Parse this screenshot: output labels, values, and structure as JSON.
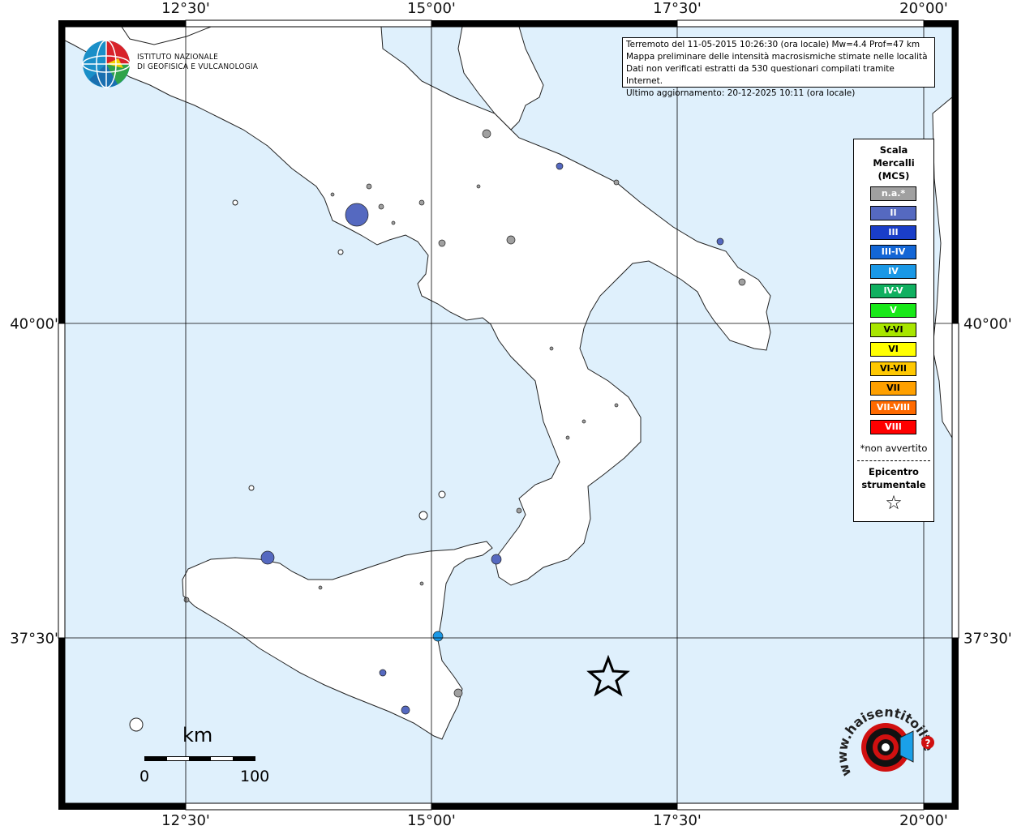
{
  "map": {
    "lon_labels": [
      "12°30'",
      "15°00'",
      "17°30'",
      "20°00'"
    ],
    "lat_labels": [
      "40°00'",
      "37°30'"
    ],
    "colors": {
      "sea": "#dff0fc",
      "land": "#ffffff",
      "frame": "#000000"
    },
    "epicenter_symbol": "star-outline"
  },
  "info_box": {
    "line1": "Terremoto del 11-05-2015 10:26:30 (ora locale) Mw=4.4 Prof=47 km",
    "line2": "Mappa preliminare delle intensità macrosismiche stimate nelle località",
    "line3": "Dati non verificati estratti da 530 questionari compilati tramite Internet.",
    "line4": "Ultimo aggiornamento: 20-12-2025 10:11 (ora locale)"
  },
  "logo": {
    "line1": "ISTITUTO NAZIONALE",
    "line2": "DI GEOFISICA E VULCANOLOGIA",
    "icon": "globe-icon"
  },
  "legend": {
    "title1": "Scala",
    "title2": "Mercalli",
    "title3": "(MCS)",
    "items": [
      {
        "label": "n.a.*",
        "color": "#a0a0a0"
      },
      {
        "label": "II",
        "color": "#5569c0"
      },
      {
        "label": "III",
        "color": "#1a3ec8"
      },
      {
        "label": "III-IV",
        "color": "#1366d6"
      },
      {
        "label": "IV",
        "color": "#1a98e6"
      },
      {
        "label": "IV-V",
        "color": "#10b060"
      },
      {
        "label": "V",
        "color": "#18e818"
      },
      {
        "label": "V-VI",
        "color": "#a8e600"
      },
      {
        "label": "VI",
        "color": "#ffff00"
      },
      {
        "label": "VI-VII",
        "color": "#ffc800"
      },
      {
        "label": "VII",
        "color": "#ffa000"
      },
      {
        "label": "VII-VIII",
        "color": "#ff6a00"
      },
      {
        "label": "VIII",
        "color": "#ff0000"
      }
    ],
    "note": "*non avvertito",
    "epicentro1": "Epicentro",
    "epicentro2": "strumentale",
    "star": "☆"
  },
  "scale": {
    "unit": "km",
    "start": "0",
    "end": "100"
  },
  "hsit_logo": {
    "text": "www.haisentitoilterremoto.it",
    "question": "?"
  }
}
